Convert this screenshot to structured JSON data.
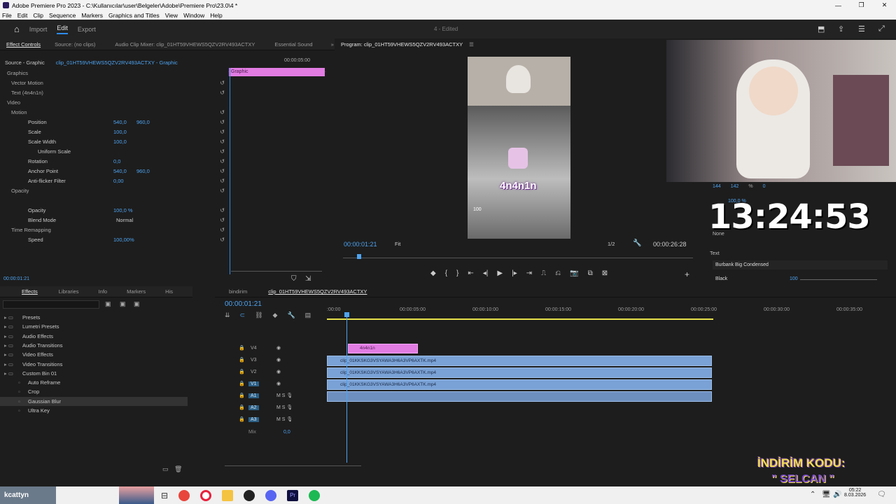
{
  "window": {
    "title": "Adobe Premiere Pro 2023 - C:\\Kullanıcılar\\user\\Belgeler\\Adobe\\Premiere Pro\\23.0\\4 *",
    "controls": [
      "—",
      "❐",
      "✕"
    ]
  },
  "menu": [
    "File",
    "Edit",
    "Clip",
    "Sequence",
    "Markers",
    "Graphics and Titles",
    "View",
    "Window",
    "Help"
  ],
  "workspaces": {
    "home": "⌂",
    "import": "Import",
    "edit": "Edit",
    "export": "Export",
    "project_title": "4 - Edited"
  },
  "top_tabs": [
    "Effect Controls",
    "Source: (no clips)",
    "Audio Clip Mixer: clip_01HT59VHEWS5QZV2RV493ACTXY",
    "Essential Sound"
  ],
  "effect_controls": {
    "source": "Source - Graphic",
    "clip": "clip_01HT59VHEWS5QZV2RV493ACTXY - Graphic",
    "timecode_head": "00:00:05:00",
    "graphic_label": "Graphic",
    "rows": [
      {
        "label": "Graphics",
        "indent": 0,
        "v1": "",
        "v2": ""
      },
      {
        "label": "Vector Motion",
        "indent": 1,
        "v1": "",
        "v2": ""
      },
      {
        "label": "Text (4n4n1n)",
        "indent": 1,
        "v1": "",
        "v2": ""
      },
      {
        "label": "Video",
        "indent": 0,
        "v1": "",
        "v2": ""
      },
      {
        "label": "Motion",
        "indent": 1,
        "v1": "",
        "v2": ""
      },
      {
        "label": "Position",
        "indent": 2,
        "v1": "540,0",
        "v2": "960,0"
      },
      {
        "label": "Scale",
        "indent": 2,
        "v1": "100,0",
        "v2": ""
      },
      {
        "label": "Scale Width",
        "indent": 2,
        "v1": "100,0",
        "v2": ""
      },
      {
        "label": "Uniform Scale",
        "indent": 3,
        "v1": "",
        "v2": ""
      },
      {
        "label": "Rotation",
        "indent": 2,
        "v1": "0,0",
        "v2": ""
      },
      {
        "label": "Anchor Point",
        "indent": 2,
        "v1": "540,0",
        "v2": "960,0"
      },
      {
        "label": "Anti-flicker Filter",
        "indent": 2,
        "v1": "0,00",
        "v2": ""
      },
      {
        "label": "Opacity",
        "indent": 1,
        "v1": "",
        "v2": ""
      },
      {
        "label": "",
        "indent": 2,
        "v1": "",
        "v2": ""
      },
      {
        "label": "Opacity",
        "indent": 2,
        "v1": "100,0 %",
        "v2": ""
      },
      {
        "label": "Blend Mode",
        "indent": 2,
        "v1": "Normal",
        "v2": ""
      },
      {
        "label": "Time Remapping",
        "indent": 1,
        "v1": "",
        "v2": ""
      },
      {
        "label": "Speed",
        "indent": 2,
        "v1": "100,00%",
        "v2": ""
      }
    ],
    "timecode": "00:00:01:21"
  },
  "program": {
    "tab": "Program: clip_01HT59VHEWS5QZV2RV493ACTXY",
    "timecode": "00:00:01:21",
    "fit": "Fit",
    "quality": "1/2",
    "duration": "00:00:26:28",
    "overlay_text": "4n4n1n",
    "hud_num": "100"
  },
  "effects_panel": {
    "tabs": [
      "Effects",
      "Libraries",
      "Info",
      "Markers",
      "His"
    ],
    "items": [
      {
        "label": "Presets",
        "indent": 0
      },
      {
        "label": "Lumetri Presets",
        "indent": 0
      },
      {
        "label": "Audio Effects",
        "indent": 0
      },
      {
        "label": "Audio Transitions",
        "indent": 0
      },
      {
        "label": "Video Effects",
        "indent": 0
      },
      {
        "label": "Video Transitions",
        "indent": 0
      },
      {
        "label": "Custom Bin 01",
        "indent": 0
      },
      {
        "label": "Auto Reframe",
        "indent": 1
      },
      {
        "label": "Crop",
        "indent": 1
      },
      {
        "label": "Gaussian Blur",
        "indent": 1
      },
      {
        "label": "Ultra Key",
        "indent": 1
      }
    ]
  },
  "timeline": {
    "tabs": [
      "bindirim",
      "clip_01HT59VHEWS5QZV2RV493ACTXY"
    ],
    "timecode": "00:00:01:21",
    "ruler": [
      ":00:00",
      "00:00:05:00",
      "00:00:10:00",
      "00:00:15:00",
      "00:00:20:00",
      "00:00:25:00",
      "00:00:30:00",
      "00:00:35:00"
    ],
    "tracks": [
      {
        "name": "V4",
        "clip": "4n4n1n"
      },
      {
        "name": "V3",
        "clip": "clip_01KKSKG3VSYAWA3H6A3VP6AXTK.mp4"
      },
      {
        "name": "V2",
        "clip": "clip_01KKSKG3VSYAWA3H6A3VP6AXTK.mp4"
      },
      {
        "name": "V1",
        "clip": "clip_01KKSKG3VSYAWA3H6A3VP6AXTK.mp4"
      },
      {
        "name": "A1",
        "clip": ""
      },
      {
        "name": "A2",
        "clip": ""
      },
      {
        "name": "A3",
        "clip": ""
      }
    ],
    "mix_label": "Mix",
    "mix_value": "0,0"
  },
  "essential": {
    "val1": "144",
    "val2": "142",
    "val3": "%",
    "val4": "0",
    "val5": "100,0 %",
    "none": "None",
    "text_label": "Text",
    "font": "Burbank Big Condensed",
    "style": "Black",
    "size": "100"
  },
  "stream_overlay": {
    "clock": "13:24:53",
    "promo1": "İNDİRİM KODU:",
    "promo2": "\" SELCAN \""
  },
  "taskbar": {
    "user": "kcattyn",
    "time": "05:22",
    "date": "8.03.2026"
  },
  "colors": {
    "accent": "#2d8ceb",
    "graphic_clip": "#e27ce3",
    "video_clip": "#7aa2d6"
  }
}
